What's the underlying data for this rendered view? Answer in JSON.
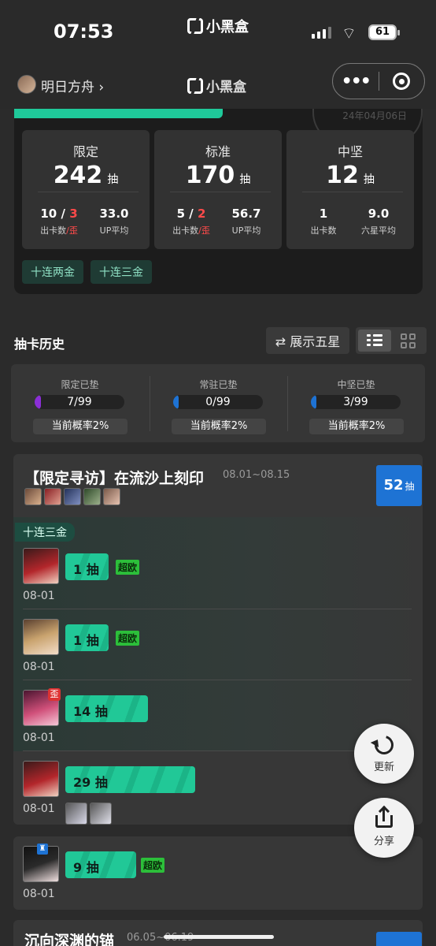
{
  "status_bar": {
    "time": "07:53",
    "app_logo_text": "小黑盒",
    "battery": "61"
  },
  "nav": {
    "game_name": "明日方舟 ›",
    "logo_text": "小黑盒",
    "more_label": "•••"
  },
  "summary": {
    "stamp_text": "24年04月06日",
    "stats": [
      {
        "title": "限定",
        "count": "242",
        "unit": "抽",
        "left_value": "10",
        "left_value_sep": " / ",
        "left_value_red": "3",
        "left_label": "出卡数",
        "left_label_red": "/歪",
        "right_value": "33.0",
        "right_label": "UP平均"
      },
      {
        "title": "标准",
        "count": "170",
        "unit": "抽",
        "left_value": "5",
        "left_value_sep": " / ",
        "left_value_red": "2",
        "left_label": "出卡数",
        "left_label_red": "/歪",
        "right_value": "56.7",
        "right_label": "UP平均"
      },
      {
        "title": "中坚",
        "count": "12",
        "unit": "抽",
        "left_value": "1",
        "left_value_sep": "",
        "left_value_red": "",
        "left_label": "出卡数",
        "left_label_red": "",
        "right_value": "9.0",
        "right_label": "六星平均"
      }
    ],
    "tags": [
      "十连两金",
      "十连三金"
    ]
  },
  "history": {
    "title": "抽卡历史",
    "show_five_star": "⇄ 展示五星",
    "pity": [
      {
        "label": "限定已垫",
        "value": "7/99",
        "fill": 0.07,
        "color": "#8b2fd6",
        "prob": "当前概率2%"
      },
      {
        "label": "常驻已垫",
        "value": "0/99",
        "fill": 0.0,
        "color": "#1e73d4",
        "prob": "当前概率2%"
      },
      {
        "label": "中坚已垫",
        "value": "3/99",
        "fill": 0.03,
        "color": "#1e73d4",
        "prob": "当前概率2%"
      }
    ]
  },
  "banner1": {
    "title": "【限定寻访】在流沙上刻印",
    "date": "08.01~08.15",
    "total": "52",
    "total_unit": "抽",
    "triple_tag": "十连三金",
    "pulls": [
      {
        "count_label": "1 抽",
        "date": "08-01",
        "badge": "超欧",
        "wai": "",
        "fill": 0.11
      },
      {
        "count_label": "1 抽",
        "date": "08-01",
        "badge": "超欧",
        "wai": "",
        "fill": 0.11
      },
      {
        "count_label": "14 抽",
        "date": "08-01",
        "badge": "",
        "wai": "歪",
        "fill": 0.21
      },
      {
        "count_label": "29 抽",
        "date": "08-01",
        "badge": "",
        "wai": "",
        "fill": 0.33
      }
    ]
  },
  "banner2": {
    "pull": {
      "count_label": "9 抽",
      "date": "08-01",
      "badge": "超欧",
      "fill": 0.18
    }
  },
  "banner3": {
    "title": "沉向深渊的锚",
    "date": "06.05~06.19"
  },
  "fab": {
    "refresh": "更新",
    "share": "分享"
  }
}
